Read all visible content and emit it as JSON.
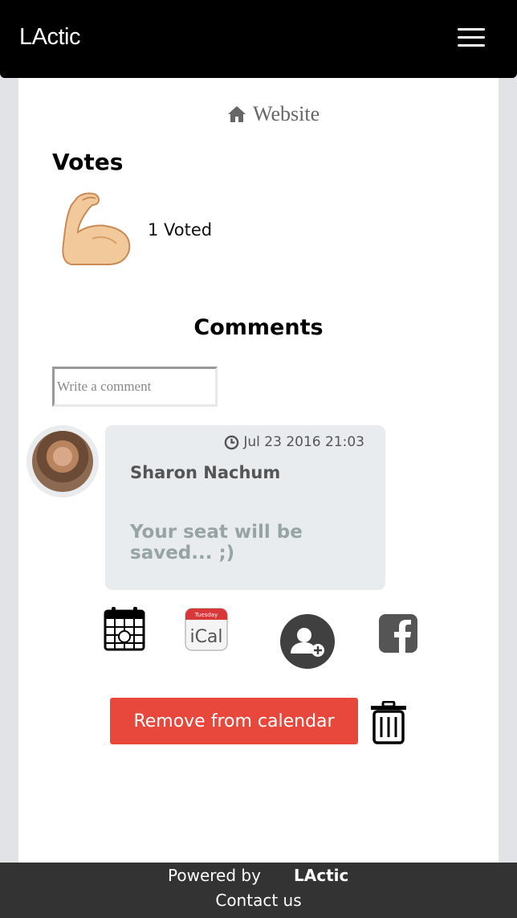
{
  "navbar": {
    "brand": "LActic",
    "menu_icon": "hamburger-menu-icon"
  },
  "links": {
    "website_label": "Website",
    "website_icon": "home-icon"
  },
  "votes": {
    "title": "Votes",
    "icon": "flexed-bicep-icon",
    "count_label": "1 Voted"
  },
  "comments": {
    "title": "Comments",
    "input_placeholder": "Write a comment",
    "items": [
      {
        "author": "Sharon Nachum",
        "timestamp": "Jul 23 2016 21:03",
        "text": "Your seat will be saved... ;)"
      }
    ]
  },
  "actions": {
    "icons": [
      "calendar-icon",
      "ical-icon",
      "add-friend-icon",
      "facebook-icon"
    ],
    "ical_day": "Tuesday",
    "ical_label": "iCal",
    "remove_label": "Remove from calendar",
    "remove_color": "#e8483b"
  },
  "footer": {
    "powered_by": "Powered by",
    "brand": "LActic",
    "contact": "Contact us"
  }
}
